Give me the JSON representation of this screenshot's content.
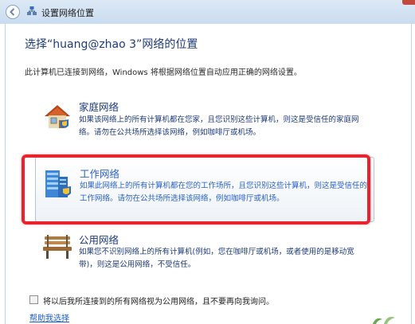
{
  "window": {
    "title": "设置网络位置",
    "back_icon": "back-arrow-icon",
    "title_icon": "network-icon"
  },
  "heading": "选择“huang@zhao  3”网络的位置",
  "description": "此计算机已连接到网络，Windows 将根据网络位置自动应用正确的网络设置。",
  "options": [
    {
      "title": "家庭网络",
      "desc": "如果该网络上的所有计算机都在您家，且您识别这些计算机，则这是受信任的家庭网络。请勿在公共场所选择该网络，例如咖啡厅或机场。",
      "icon": "house-icon"
    },
    {
      "title": "工作网络",
      "desc": "如果此网络上的所有计算机都在您的工作场所，且您识别这些计算机，则这是受信任的工作网络。请勿在公共场所选择该网络，例如咖啡厅或机场。",
      "icon": "office-building-icon",
      "highlighted": true
    },
    {
      "title": "公用网络",
      "desc": "如果您不识别网络上的所有计算机(例如，您在咖啡厅或机场，或者使用的是移动宽带)，则这是公用网络，不受信任。",
      "icon": "park-bench-icon"
    }
  ],
  "checkbox": {
    "label": "将以后我所连接到的所有网络视为公用网络，且不要再向我询问。",
    "checked": false
  },
  "help_link": "帮助我选择",
  "colors": {
    "link_blue": "#1e3a7a",
    "selected_blue": "#2b62c8",
    "highlight_red": "#e8222e"
  }
}
